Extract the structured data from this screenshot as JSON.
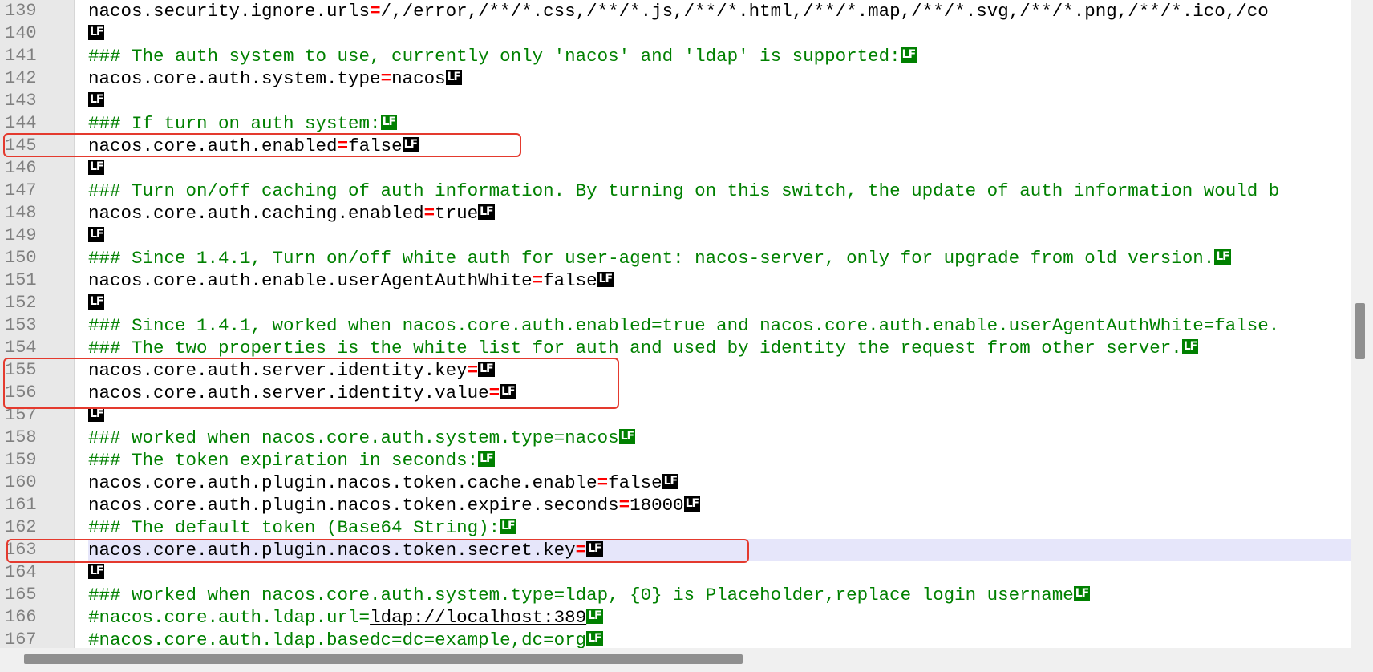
{
  "editor": {
    "lines": [
      {
        "n": "139",
        "tokens": [
          {
            "t": "nacos.security.ignore.urls",
            "k": "key"
          },
          {
            "t": "=",
            "k": "eq"
          },
          {
            "t": "/,/error,/**/*.css,/**/*.js,/**/*.html,/**/*.map,/**/*.svg,/**/*.png,/**/*.ico,/co",
            "k": "val"
          }
        ],
        "eol": false
      },
      {
        "n": "140",
        "tokens": [],
        "eol": "black"
      },
      {
        "n": "141",
        "tokens": [
          {
            "t": "### The auth system to use, currently only 'nacos' and 'ldap' is supported:",
            "k": "comment"
          }
        ],
        "eol": "green"
      },
      {
        "n": "142",
        "tokens": [
          {
            "t": "nacos.core.auth.system.type",
            "k": "key"
          },
          {
            "t": "=",
            "k": "eq"
          },
          {
            "t": "nacos",
            "k": "val"
          }
        ],
        "eol": "black"
      },
      {
        "n": "143",
        "tokens": [],
        "eol": "black"
      },
      {
        "n": "144",
        "tokens": [
          {
            "t": "### If turn on auth system:",
            "k": "comment"
          }
        ],
        "eol": "green"
      },
      {
        "n": "145",
        "tokens": [
          {
            "t": "nacos.core.auth.enabled",
            "k": "key"
          },
          {
            "t": "=",
            "k": "eq"
          },
          {
            "t": "false",
            "k": "val"
          }
        ],
        "eol": "black"
      },
      {
        "n": "146",
        "tokens": [],
        "eol": "black"
      },
      {
        "n": "147",
        "tokens": [
          {
            "t": "### Turn on/off caching of auth information. By turning on this switch, the update of auth information would b",
            "k": "comment"
          }
        ],
        "eol": false
      },
      {
        "n": "148",
        "tokens": [
          {
            "t": "nacos.core.auth.caching.enabled",
            "k": "key"
          },
          {
            "t": "=",
            "k": "eq"
          },
          {
            "t": "true",
            "k": "val"
          }
        ],
        "eol": "black"
      },
      {
        "n": "149",
        "tokens": [],
        "eol": "black"
      },
      {
        "n": "150",
        "tokens": [
          {
            "t": "### Since 1.4.1, Turn on/off white auth for user-agent: nacos-server, only for upgrade from old version.",
            "k": "comment"
          }
        ],
        "eol": "green"
      },
      {
        "n": "151",
        "tokens": [
          {
            "t": "nacos.core.auth.enable.userAgentAuthWhite",
            "k": "key"
          },
          {
            "t": "=",
            "k": "eq"
          },
          {
            "t": "false",
            "k": "val"
          }
        ],
        "eol": "black"
      },
      {
        "n": "152",
        "tokens": [],
        "eol": "black"
      },
      {
        "n": "153",
        "tokens": [
          {
            "t": "### Since 1.4.1, worked when nacos.core.auth.enabled=true and nacos.core.auth.enable.userAgentAuthWhite=false.",
            "k": "comment"
          }
        ],
        "eol": false
      },
      {
        "n": "154",
        "tokens": [
          {
            "t": "### The two properties is the white list for auth and used by identity the request from other server.",
            "k": "comment"
          }
        ],
        "eol": "green"
      },
      {
        "n": "155",
        "tokens": [
          {
            "t": "nacos.core.auth.server.identity.key",
            "k": "key"
          },
          {
            "t": "=",
            "k": "eq"
          }
        ],
        "eol": "black"
      },
      {
        "n": "156",
        "tokens": [
          {
            "t": "nacos.core.auth.server.identity.value",
            "k": "key"
          },
          {
            "t": "=",
            "k": "eq"
          }
        ],
        "eol": "black"
      },
      {
        "n": "157",
        "tokens": [],
        "eol": "black"
      },
      {
        "n": "158",
        "tokens": [
          {
            "t": "### worked when nacos.core.auth.system.type=nacos",
            "k": "comment"
          }
        ],
        "eol": "green"
      },
      {
        "n": "159",
        "tokens": [
          {
            "t": "### The token expiration in seconds:",
            "k": "comment"
          }
        ],
        "eol": "green"
      },
      {
        "n": "160",
        "tokens": [
          {
            "t": "nacos.core.auth.plugin.nacos.token.cache.enable",
            "k": "key"
          },
          {
            "t": "=",
            "k": "eq"
          },
          {
            "t": "false",
            "k": "val"
          }
        ],
        "eol": "black"
      },
      {
        "n": "161",
        "tokens": [
          {
            "t": "nacos.core.auth.plugin.nacos.token.expire.seconds",
            "k": "key"
          },
          {
            "t": "=",
            "k": "eq"
          },
          {
            "t": "18000",
            "k": "val"
          }
        ],
        "eol": "black"
      },
      {
        "n": "162",
        "tokens": [
          {
            "t": "### The default token (Base64 String):",
            "k": "comment"
          }
        ],
        "eol": "green"
      },
      {
        "n": "163",
        "tokens": [
          {
            "t": "nacos.core.auth.plugin.nacos.token.secret.key",
            "k": "key"
          },
          {
            "t": "=",
            "k": "eq"
          }
        ],
        "eol": "black",
        "current": true
      },
      {
        "n": "164",
        "tokens": [],
        "eol": "black"
      },
      {
        "n": "165",
        "tokens": [
          {
            "t": "### worked when nacos.core.auth.system.type=ldap, {0} is Placeholder,replace login username",
            "k": "comment"
          }
        ],
        "eol": "green"
      },
      {
        "n": "166",
        "tokens": [
          {
            "t": "#nacos.core.auth.ldap.url=",
            "k": "comment"
          },
          {
            "t": "ldap://localhost:389",
            "k": "commenturl"
          }
        ],
        "eol": "green"
      },
      {
        "n": "167",
        "tokens": [
          {
            "t": "#nacos.core.auth.ldap.basedc=dc=example,dc=org",
            "k": "comment"
          }
        ],
        "eol": "green"
      }
    ],
    "eol_label": "LF",
    "highlighted_lines": [
      "145",
      "155-156",
      "163"
    ]
  },
  "colors": {
    "comment": "#008000",
    "equals": "#ff0000",
    "highlight_box": "#e43a2e",
    "current_line": "#e6e6fa"
  }
}
